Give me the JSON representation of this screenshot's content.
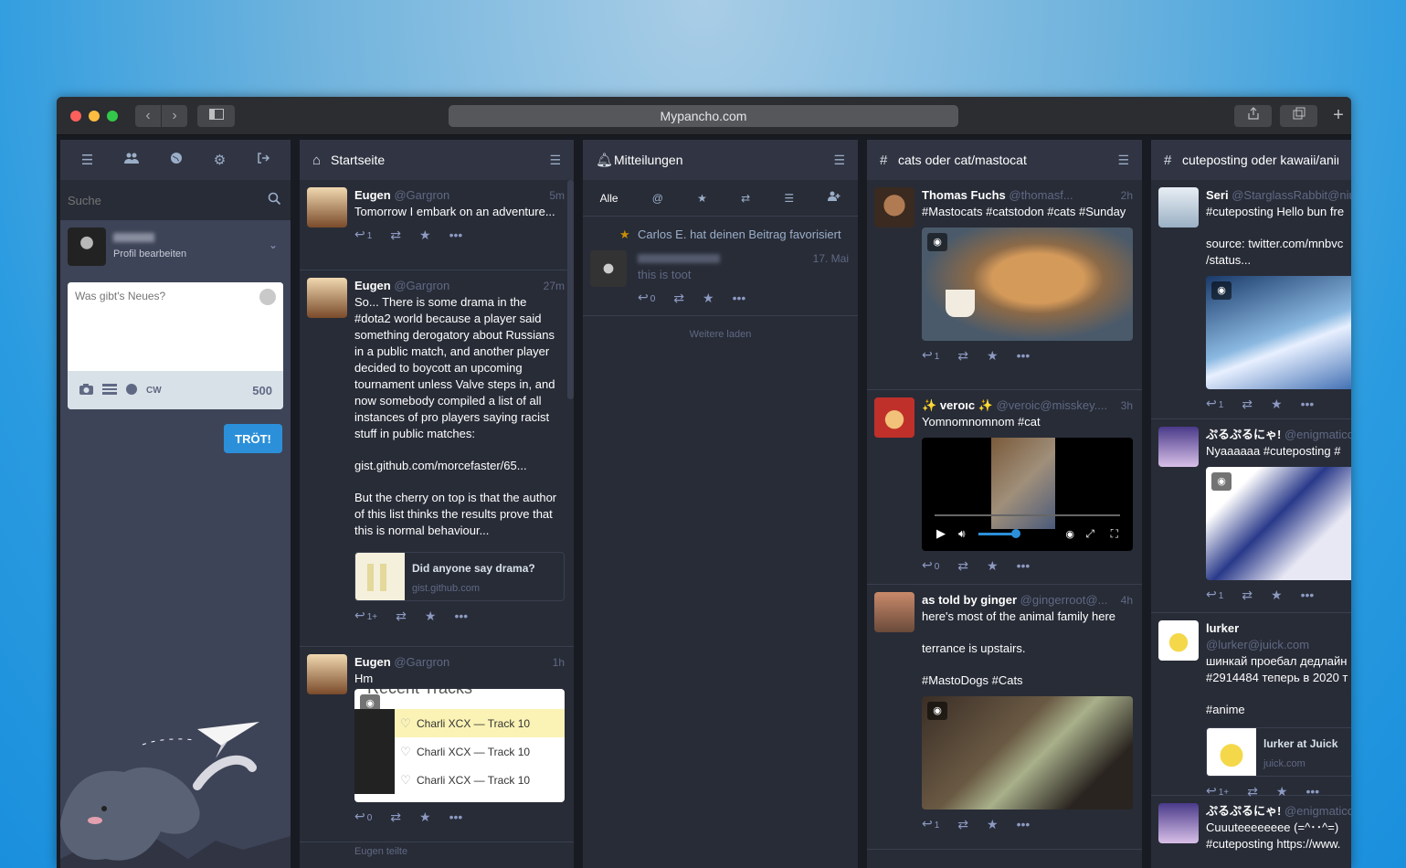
{
  "browser": {
    "url": "Mypancho.com",
    "back": "‹",
    "forward": "›"
  },
  "sidebar": {
    "search_placeholder": "Suche",
    "profile_edit": "Profil bearbeiten",
    "compose_placeholder": "Was gibt's Neues?",
    "cw": "CW",
    "char_count": "500",
    "toot_button": "TRÖT!"
  },
  "columns": {
    "home": {
      "title": "Startseite",
      "statuses": [
        {
          "name": "Eugen",
          "handle": "@Gargron",
          "time": "5m",
          "text": "Tomorrow I embark on an adventure...",
          "reply": "1"
        },
        {
          "name": "Eugen",
          "handle": "@Gargron",
          "time": "27m",
          "text": "So... There is some drama in the #dota2 world because a player said something derogatory about Russians in a public match, and another player decided to boycott an upcoming tournament unless Valve steps in, and now somebody compiled a list of all instances of pro players saying racist stuff in public matches:",
          "link": "gist.github.com/morcefaster/65...",
          "text2": "But the cherry on top is that the author of this list thinks the results prove that this is normal behaviour...",
          "card_title": "Did anyone say drama?",
          "card_url": "gist.github.com",
          "reply": "1+"
        },
        {
          "name": "Eugen",
          "handle": "@Gargron",
          "time": "1h",
          "text": "Hm",
          "media_caption": "Recent Tracks",
          "tracks": [
            "Charli XCX — Track 10",
            "Charli XCX — Track 10",
            "Charli XCX — Track 10"
          ],
          "reply": "0"
        }
      ],
      "boost_line": "Eugen teilte"
    },
    "notifications": {
      "title": "Mitteilungen",
      "filters": [
        "Alle"
      ],
      "fav_text": "Carlos E. hat deinen Beitrag favorisiert",
      "toot_text": "this is toot",
      "toot_time": "17. Mai",
      "reply": "0",
      "load_more": "Weitere laden"
    },
    "cats": {
      "title": "cats oder cat/mastocat",
      "statuses": [
        {
          "name": "Thomas Fuchs",
          "handle": "@thomasf...",
          "time": "2h",
          "text": "#Mastocats #catstodon #cats #Sunday",
          "reply": "1"
        },
        {
          "name": "veroıc",
          "handle": "@veroic@misskey....",
          "time": "3h",
          "text": "Yomnomnomnom #cat",
          "reply": "0"
        },
        {
          "name": "as told by ginger",
          "handle": "@gingerroot@...",
          "time": "4h",
          "text": "here's most of the animal family here",
          "text2": "terrance is upstairs.",
          "text3": "#MastoDogs #Cats",
          "reply": "1"
        }
      ]
    },
    "cute": {
      "title": "cuteposting oder kawaii/anime",
      "statuses": [
        {
          "name": "Seri",
          "handle": "@StarglassRabbit@niu",
          "text": "#cuteposting Hello bun fre",
          "text2": "source: twitter.com/mnbvc /status...",
          "reply": "1"
        },
        {
          "name": "ぷるぷるにゃ!",
          "handle": "@enigmatico@",
          "text": "Nyaaaaaa #cuteposting #",
          "reply": "1"
        },
        {
          "name": "lurker",
          "handle": "@lurker@juick.com",
          "text": "шинкай проебал дедлайн #2914484 теперь в 2020 т",
          "text2": "#anime",
          "card_title": "lurker at Juick",
          "card_url": "juick.com",
          "reply": "1+"
        },
        {
          "name": "ぷるぷるにゃ!",
          "handle": "@enigmatico@",
          "text": "Cuuuteeeeeeee (=^･･^=) #cuteposting https://www."
        }
      ]
    }
  },
  "colors": {
    "bg": "#282c37",
    "head": "#313543",
    "accent": "#2b90d9",
    "muted": "#606984"
  }
}
